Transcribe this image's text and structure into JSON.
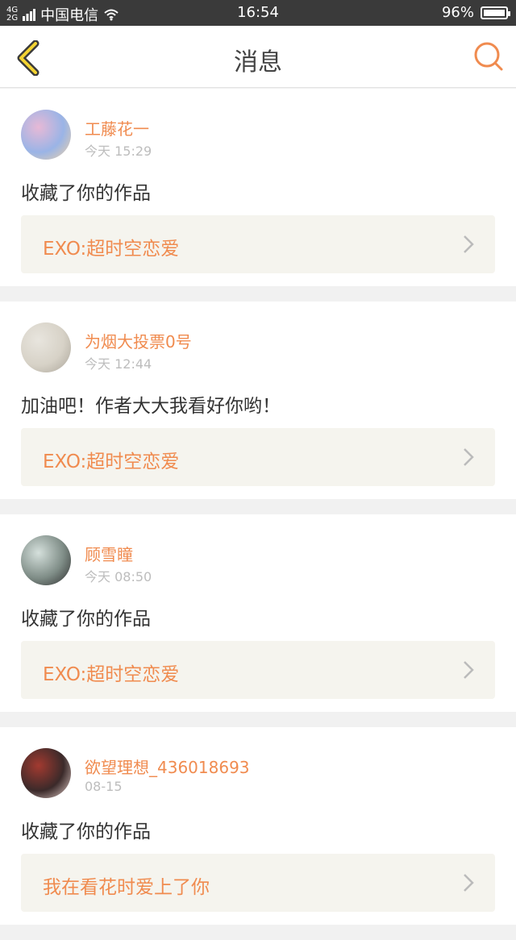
{
  "status_bar": {
    "network_top": "4G",
    "network_bottom": "2G",
    "carrier": "中国电信",
    "time": "16:54",
    "battery": "96%",
    "battery_level": 0.96
  },
  "header": {
    "title": "消息",
    "back_icon": "chevron-left-icon",
    "search_icon": "search-icon",
    "accent_color": "#f08b4f"
  },
  "messages": [
    {
      "username": "工藤花一",
      "time": "今天 15:29",
      "text": "收藏了你的作品",
      "work_title": "EXO:超时空恋爱",
      "avatar_colors": [
        "#e7b9d6",
        "#9ab4e6",
        "#f1d2a5"
      ]
    },
    {
      "username": "为烟大投票0号",
      "time": "今天 12:44",
      "text": "加油吧！作者大大我看好你哟！",
      "work_title": "EXO:超时空恋爱",
      "avatar_colors": [
        "#e8e5de",
        "#d7d2c7",
        "#a9a398"
      ]
    },
    {
      "username": "顾雪瞳",
      "time": "今天 08:50",
      "text": "收藏了你的作品",
      "work_title": "EXO:超时空恋爱",
      "avatar_colors": [
        "#d5e0dc",
        "#7f8d87",
        "#2b2b2b"
      ]
    },
    {
      "username": "欲望理想_436018693",
      "time": "08-15",
      "text": "收藏了你的作品",
      "work_title": "我在看花时爱上了你",
      "avatar_colors": [
        "#a23a30",
        "#3b2a2a",
        "#e9d4cf"
      ]
    }
  ]
}
